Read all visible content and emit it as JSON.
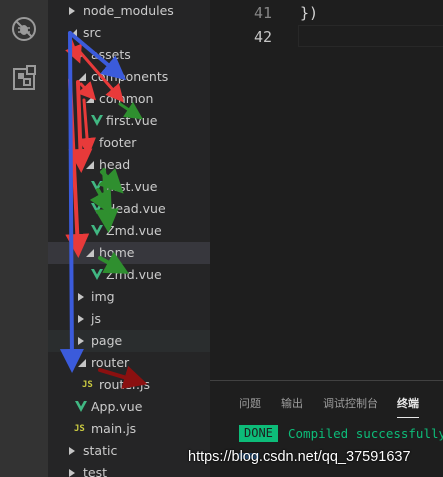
{
  "explorer": {
    "items": [
      {
        "label": "node_modules"
      },
      {
        "label": "src"
      },
      {
        "label": "assets"
      },
      {
        "label": "components"
      },
      {
        "label": "common"
      },
      {
        "label": "first.vue"
      },
      {
        "label": "footer"
      },
      {
        "label": "head"
      },
      {
        "label": "first.vue"
      },
      {
        "label": "Head.vue"
      },
      {
        "label": "Zmd.vue"
      },
      {
        "label": "home"
      },
      {
        "label": "Zmd.vue"
      },
      {
        "label": "img"
      },
      {
        "label": "js"
      },
      {
        "label": "page"
      },
      {
        "label": "router"
      },
      {
        "label": "router.js"
      },
      {
        "label": "App.vue"
      },
      {
        "label": "main.js"
      },
      {
        "label": "static"
      },
      {
        "label": "test"
      }
    ],
    "js_badge": "JS"
  },
  "editor": {
    "lines": [
      {
        "number": "41",
        "code": "})"
      },
      {
        "number": "42",
        "code": ""
      }
    ]
  },
  "panel": {
    "tabs": [
      "问题",
      "输出",
      "调试控制台",
      "终端"
    ],
    "done_badge": "DONE",
    "terminal_text": "Compiled successfully"
  },
  "watermark": "https://blog.csdn.net/qq_37591637",
  "colors": {
    "arrow_red": "#e83a3a",
    "arrow_blue": "#3b5bdb",
    "arrow_green": "#2f8f2f",
    "arrow_darkred": "#8b1010",
    "vue_green": "#41b883",
    "terminal_green": "#0dbc79"
  }
}
